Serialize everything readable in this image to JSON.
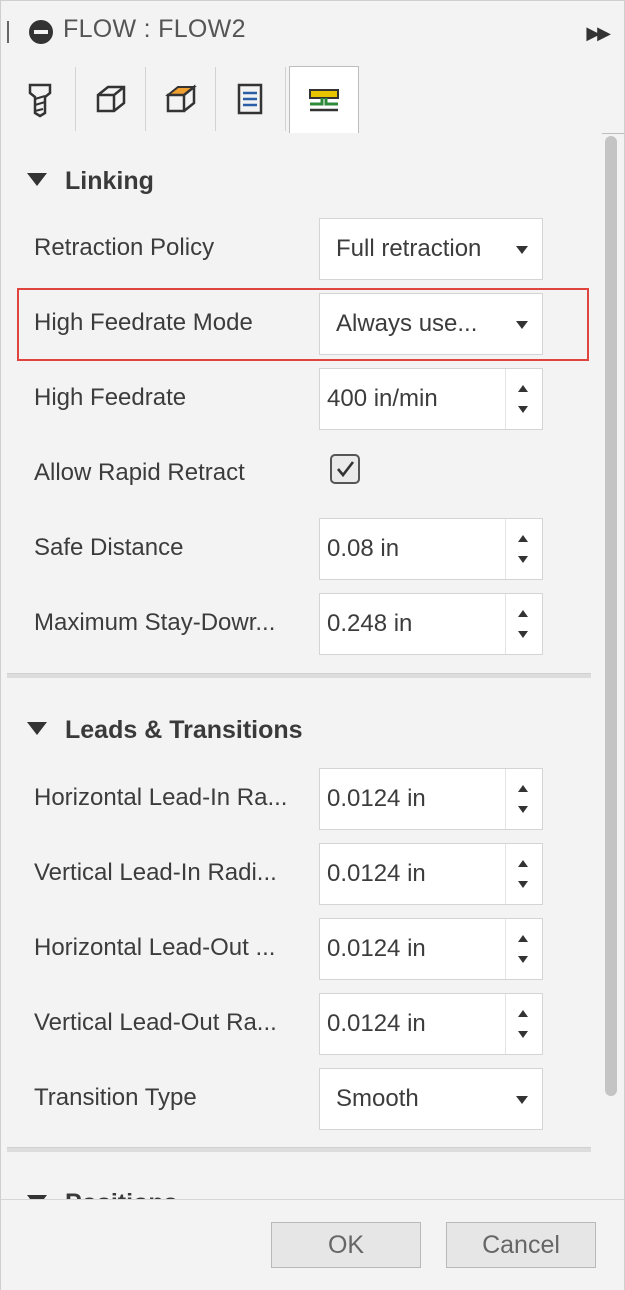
{
  "title": "FLOW : FLOW2",
  "tabs": [
    {
      "icon": "tool-icon"
    },
    {
      "icon": "geometry-icon"
    },
    {
      "icon": "heights-icon"
    },
    {
      "icon": "passes-icon"
    },
    {
      "icon": "linking-icon",
      "active": true
    }
  ],
  "sections": {
    "linking": {
      "label": "Linking",
      "rows": [
        {
          "label": "Retraction Policy",
          "type": "dropdown",
          "value": "Full retraction"
        },
        {
          "label": "High Feedrate Mode",
          "type": "dropdown",
          "value": "Always use..."
        },
        {
          "label": "High Feedrate",
          "type": "spinner",
          "value": "400 in/min"
        },
        {
          "label": "Allow Rapid Retract",
          "type": "checkbox",
          "checked": true
        },
        {
          "label": "Safe Distance",
          "type": "spinner",
          "value": "0.08 in"
        },
        {
          "label": "Maximum Stay-Dowr...",
          "type": "spinner",
          "value": "0.248 in"
        }
      ]
    },
    "leads": {
      "label": "Leads & Transitions",
      "rows": [
        {
          "label": "Horizontal Lead-In Ra...",
          "type": "spinner",
          "value": "0.0124 in"
        },
        {
          "label": "Vertical Lead-In Radi...",
          "type": "spinner",
          "value": "0.0124 in"
        },
        {
          "label": "Horizontal Lead-Out ...",
          "type": "spinner",
          "value": "0.0124 in"
        },
        {
          "label": "Vertical Lead-Out Ra...",
          "type": "spinner",
          "value": "0.0124 in"
        },
        {
          "label": "Transition Type",
          "type": "dropdown",
          "value": "Smooth"
        }
      ]
    },
    "positions": {
      "label": "Positions"
    }
  },
  "footer": {
    "ok_label": "OK",
    "cancel_label": "Cancel"
  },
  "colors": {
    "highlight": "#e0443e",
    "panel": "#f3f3f3",
    "tab_yellow": "#e8c400",
    "tab_green": "#2f8a3a"
  }
}
